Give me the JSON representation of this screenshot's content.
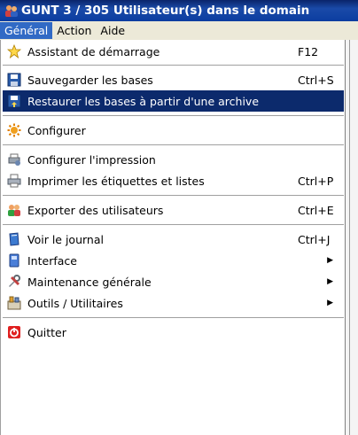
{
  "window": {
    "title": "GUNT 3 / 305 Utilisateur(s) dans le domain"
  },
  "menubar": [
    "Général",
    "Action",
    "Aide"
  ],
  "menu": {
    "assistant": {
      "label": "Assistant de démarrage",
      "shortcut": "F12"
    },
    "sauvegarder": {
      "label": "Sauvegarder les bases",
      "shortcut": "Ctrl+S"
    },
    "restaurer": {
      "label": "Restaurer les bases à partir d'une archive"
    },
    "configurer": {
      "label": "Configurer"
    },
    "config_impression": {
      "label": "Configurer l'impression"
    },
    "imprimer": {
      "label": "Imprimer les étiquettes et listes",
      "shortcut": "Ctrl+P"
    },
    "exporter": {
      "label": "Exporter des utilisateurs",
      "shortcut": "Ctrl+E"
    },
    "journal": {
      "label": "Voir le journal",
      "shortcut": "Ctrl+J"
    },
    "interface": {
      "label": "Interface"
    },
    "maintenance": {
      "label": "Maintenance générale"
    },
    "outils": {
      "label": "Outils / Utilitaires"
    },
    "quitter": {
      "label": "Quitter"
    }
  },
  "colors": {
    "highlight": "#0c2a6c",
    "titlebar": "#0a246a",
    "menubar_active": "#316ac5"
  }
}
